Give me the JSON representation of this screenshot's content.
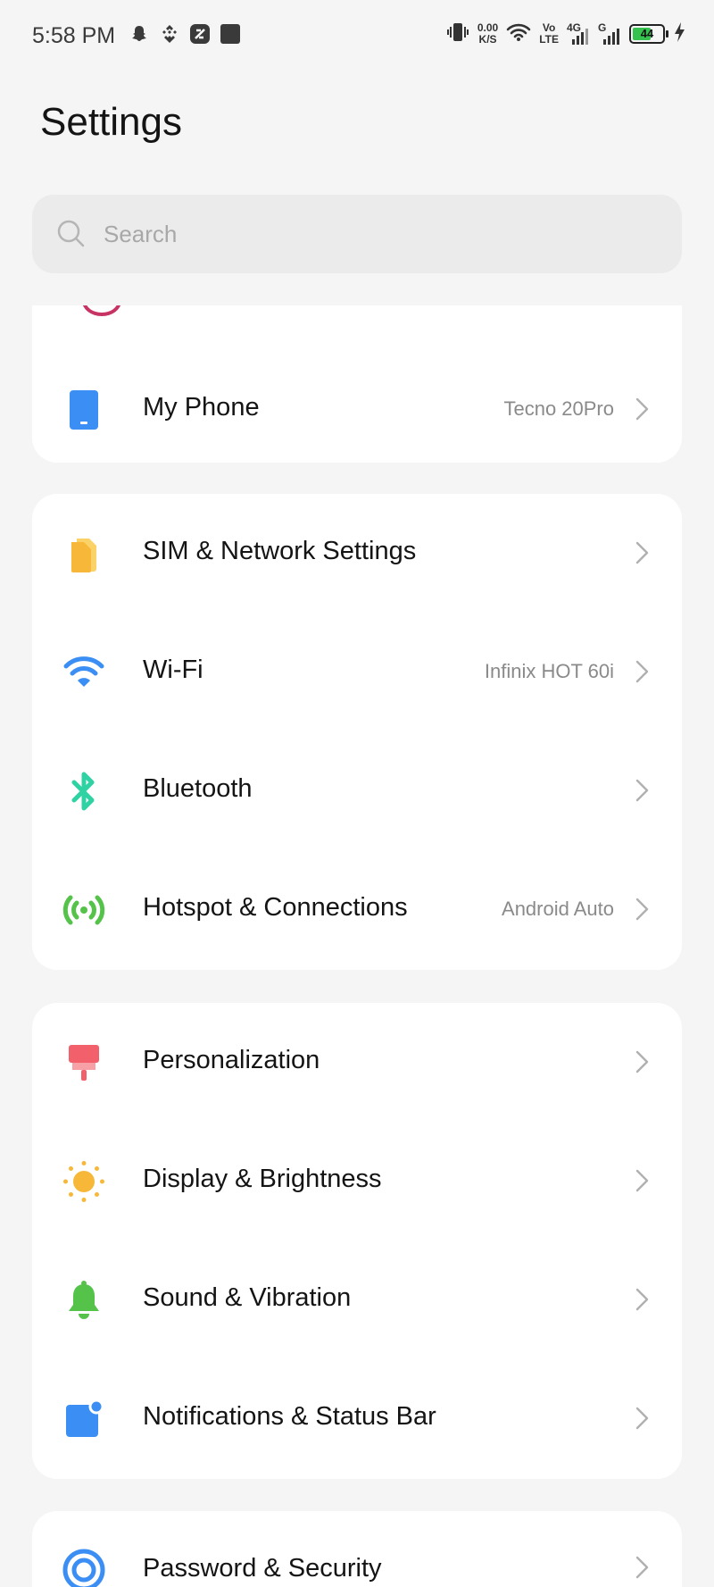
{
  "status_bar": {
    "time": "5:58 PM",
    "speed_value": "0.00",
    "speed_unit": "K/S",
    "volte_top": "Vo",
    "volte_bottom": "LTE",
    "net1": "4G",
    "net2": "G",
    "battery": "44",
    "battery_color": "#36c24f"
  },
  "title": "Settings",
  "search": {
    "placeholder": "Search"
  },
  "groups": [
    {
      "rows": [
        {
          "label": "My Phone",
          "value": "Tecno 20Pro",
          "icon": "phone-icon",
          "color": "#3b8ef3"
        }
      ]
    },
    {
      "rows": [
        {
          "label": "SIM & Network Settings",
          "value": "",
          "icon": "sim-icon",
          "color": "#f7b83a"
        },
        {
          "label": "Wi-Fi",
          "value": "Infinix HOT 60i",
          "icon": "wifi-icon",
          "color": "#3b8ef3"
        },
        {
          "label": "Bluetooth",
          "value": "",
          "icon": "bluetooth-icon",
          "color": "#2fd3a3"
        },
        {
          "label": "Hotspot & Connections",
          "value": "Android Auto",
          "icon": "hotspot-icon",
          "color": "#55c24a"
        }
      ]
    },
    {
      "rows": [
        {
          "label": "Personalization",
          "value": "",
          "icon": "personalization-icon",
          "color": "#f2606b"
        },
        {
          "label": "Display & Brightness",
          "value": "",
          "icon": "sun-icon",
          "color": "#f7b83a"
        },
        {
          "label": "Sound & Vibration",
          "value": "",
          "icon": "bell-icon",
          "color": "#55c24a"
        },
        {
          "label": "Notifications & Status Bar",
          "value": "",
          "icon": "notification-icon",
          "color": "#3b8ef3"
        }
      ]
    },
    {
      "rows": [
        {
          "label": "Password & Security",
          "value": "",
          "icon": "security-icon",
          "color": "#3b8ef3"
        }
      ]
    }
  ]
}
